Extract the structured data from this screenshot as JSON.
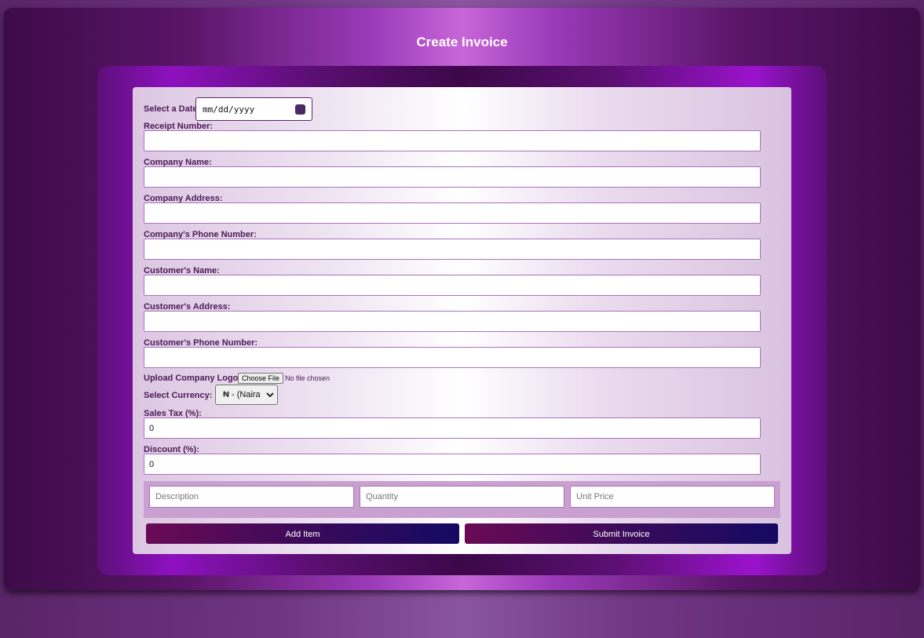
{
  "header": {
    "title": "Create Invoice"
  },
  "form": {
    "date": {
      "label": "Select a Date",
      "placeholder": "mm/dd/yyyy"
    },
    "receipt_number": {
      "label": "Receipt Number:",
      "value": ""
    },
    "company_name": {
      "label": "Company Name:",
      "value": ""
    },
    "company_address": {
      "label": "Company Address:",
      "value": ""
    },
    "company_phone": {
      "label": "Company's Phone Number:",
      "value": ""
    },
    "customer_name": {
      "label": "Customer's Name:",
      "value": ""
    },
    "customer_address": {
      "label": "Customer's Address:",
      "value": ""
    },
    "customer_phone": {
      "label": "Customer's Phone Number:",
      "value": ""
    },
    "logo": {
      "label": "Upload Company Logo:",
      "button_label": "Choose File",
      "status": "No file chosen"
    },
    "currency": {
      "label": "Select Currency:",
      "selected": "₦ - (Naira"
    },
    "sales_tax": {
      "label": "Sales Tax (%):",
      "value": "0"
    },
    "discount": {
      "label": "Discount (%):",
      "value": "0"
    }
  },
  "item_row": {
    "description_placeholder": "Description",
    "quantity_placeholder": "Quantity",
    "unit_price_placeholder": "Unit Price"
  },
  "actions": {
    "add_item_label": "Add Item",
    "submit_label": "Submit Invoice"
  },
  "icons": {
    "date_picker": "calendar-icon",
    "select_arrow": "chevron-down-icon"
  },
  "colors": {
    "label_text": "#4a1a55",
    "button_start": "#6a0a55",
    "button_end": "#140a62",
    "input_border": "#a873bc"
  }
}
